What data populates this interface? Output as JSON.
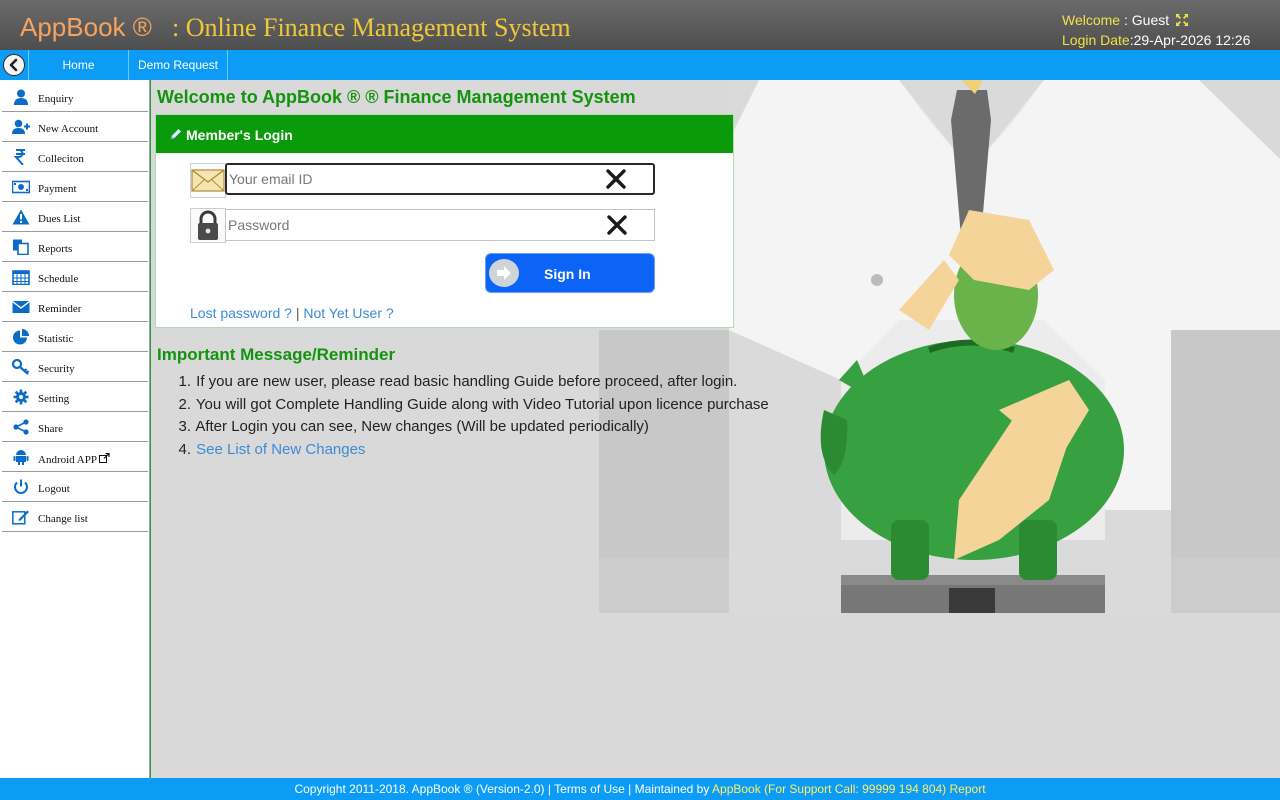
{
  "header": {
    "brand": "AppBook ®",
    "subtitle": ": Online Finance Management System",
    "welcome_label": "Welcome",
    "welcome_sep": " : ",
    "welcome_user": "Guest",
    "login_date_label": "Login Date",
    "login_date_value": ":29-Apr-2026 12:26"
  },
  "navbar": {
    "items": [
      {
        "label": "Home"
      },
      {
        "label": "Demo Request"
      }
    ]
  },
  "sidebar": {
    "items": [
      {
        "label": "Enquiry",
        "icon": "user-icon"
      },
      {
        "label": "New Account",
        "icon": "user-plus-icon"
      },
      {
        "label": "Colleciton",
        "icon": "rupee-icon"
      },
      {
        "label": "Payment",
        "icon": "money-icon"
      },
      {
        "label": "Dues List",
        "icon": "warning-icon"
      },
      {
        "label": "Reports",
        "icon": "copy-icon"
      },
      {
        "label": "Schedule",
        "icon": "calendar-icon"
      },
      {
        "label": "Reminder",
        "icon": "envelope-icon"
      },
      {
        "label": "Statistic",
        "icon": "pie-chart-icon"
      },
      {
        "label": "Security",
        "icon": "key-icon"
      },
      {
        "label": "Setting",
        "icon": "gear-icon"
      },
      {
        "label": "Share",
        "icon": "share-icon"
      },
      {
        "label": "Android APP",
        "icon": "android-icon"
      },
      {
        "label": "Logout",
        "icon": "power-icon"
      },
      {
        "label": "Change list",
        "icon": "edit-icon"
      }
    ]
  },
  "main": {
    "welcome_title": "Welcome to AppBook ® ® Finance Management System",
    "login": {
      "title": "Member's Login",
      "email_placeholder": "Your email ID",
      "email_value": "",
      "password_placeholder": "Password",
      "password_value": "",
      "signin_label": "Sign In",
      "lost_password": "Lost password ?",
      "separator": "|",
      "not_yet_user": "Not Yet User ?"
    },
    "messages": {
      "title": "Important Message/Reminder",
      "items": [
        {
          "num": "1.",
          "text": "If you are new user, please read basic handling Guide before proceed, after login."
        },
        {
          "num": "2.",
          "text": "You will got Complete Handling Guide along with Video Tutorial upon licence purchase"
        },
        {
          "num": "3.",
          "text": "After Login you can see, New changes (Will be updated periodically)"
        },
        {
          "num": "4.",
          "text": "See List of New Changes"
        }
      ]
    }
  },
  "footer": {
    "copyright": "Copyright 2011-2018. AppBook ® (Version-2.0) |",
    "terms": "Terms of Use",
    "maintained": "| Maintained by",
    "maintainer": "AppBook",
    "support": "(For Support Call: 99999 194 804)",
    "report": "Report"
  },
  "colors": {
    "nav_blue": "#0d9cf5",
    "header_gray": "#5a5a5a",
    "brand_orange": "#f4a460",
    "brand_yellow": "#f0c838",
    "green": "#0a9a0a",
    "signin_blue": "#0b64f5",
    "link_blue": "#3d8bd6"
  }
}
